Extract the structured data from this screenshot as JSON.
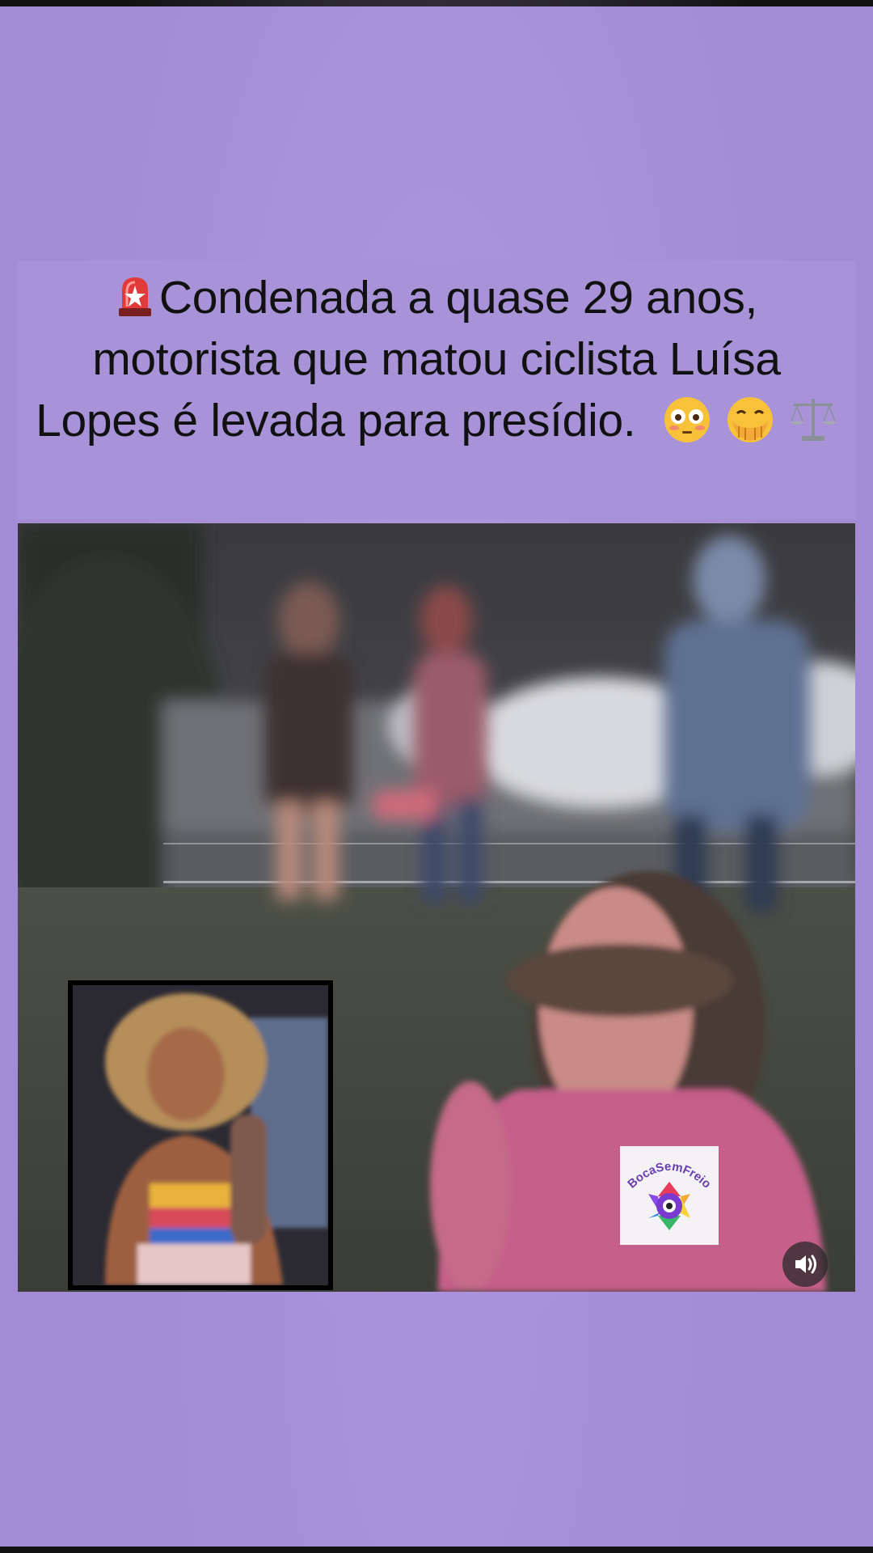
{
  "post": {
    "headline_text": "Condenada a quase 29 anos, motorista que matou ciclista Luísa Lopes é levada para presídio.",
    "headline_icons": [
      "rotating-light-icon",
      "flushed-face-icon",
      "face-with-hand-over-mouth-icon",
      "balance-scale-icon"
    ]
  },
  "video": {
    "watermark_text": "BocaSemFreio",
    "controls": {
      "sound_icon": "speaker-on-icon"
    }
  },
  "colors": {
    "background": "#a48bd6",
    "headline_box": "#a892d8",
    "headline_text": "#111111"
  }
}
